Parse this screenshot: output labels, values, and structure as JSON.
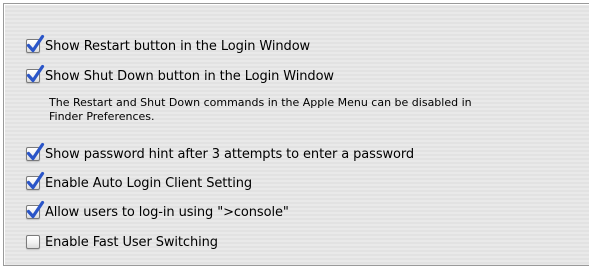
{
  "options": [
    {
      "label": "Show Restart button in the Login Window",
      "checked": true
    },
    {
      "label": "Show Shut Down button in the Login Window",
      "checked": true
    },
    {
      "label": "Show password hint after 3 attempts to enter a password",
      "checked": true
    },
    {
      "label": "Enable Auto Login Client Setting",
      "checked": true
    },
    {
      "label": "Allow users to log-in using \">console\"",
      "checked": true
    },
    {
      "label": "Enable Fast User Switching",
      "checked": false
    }
  ],
  "note": {
    "line1": "The Restart and Shut Down commands in the Apple Menu can be disabled in",
    "line2": "Finder Preferences."
  },
  "colors": {
    "check": "#2a55c8",
    "panel_bg": "#e6e6e6"
  },
  "icons": {
    "checked": "checkmark-icon"
  }
}
